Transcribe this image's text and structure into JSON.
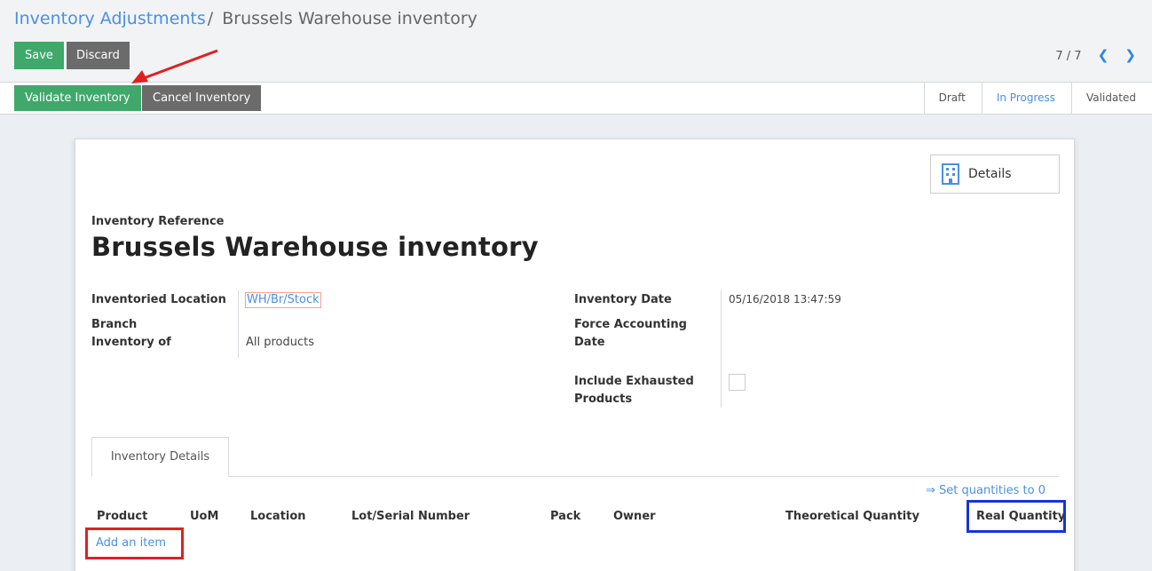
{
  "breadcrumb": {
    "parent": "Inventory Adjustments",
    "separator": "/",
    "current": "Brussels Warehouse inventory"
  },
  "toolbar": {
    "save_label": "Save",
    "discard_label": "Discard"
  },
  "pager": {
    "text": "7 / 7",
    "prev_icon": "chevron-left-icon",
    "next_icon": "chevron-right-icon"
  },
  "statusbar": {
    "validate_label": "Validate Inventory",
    "cancel_label": "Cancel Inventory",
    "stages": [
      "Draft",
      "In Progress",
      "Validated"
    ],
    "active_stage": "In Progress"
  },
  "sheet": {
    "details_button": {
      "label": "Details",
      "icon": "building-icon"
    },
    "reference_label": "Inventory Reference",
    "title": "Brussels Warehouse inventory",
    "left_fields": {
      "location_label": "Inventoried Location",
      "location_value": "WH/Br/Stock",
      "branch_label": "Branch",
      "inventory_of_label": "Inventory of",
      "inventory_of_value": "All products"
    },
    "right_fields": {
      "date_label": "Inventory Date",
      "date_value": "05/16/2018 13:47:59",
      "force_date_label_1": "Force Accounting",
      "force_date_label_2": "Date",
      "include_label_1": "Include Exhausted",
      "include_label_2": "Products",
      "include_checked": false
    },
    "tabs": [
      "Inventory Details"
    ],
    "set_quantities": "⇒ Set quantities to 0",
    "columns": [
      "Product",
      "UoM",
      "Location",
      "Lot/Serial Number",
      "Pack",
      "Owner",
      "Theoretical Quantity",
      "Real Quantity"
    ],
    "add_item": "Add an item"
  },
  "colors": {
    "green": "#3fa86a",
    "grey": "#6b6b6b",
    "link": "#4a90e2",
    "highlight_red": "#e02020",
    "highlight_blue": "#1535d8"
  }
}
